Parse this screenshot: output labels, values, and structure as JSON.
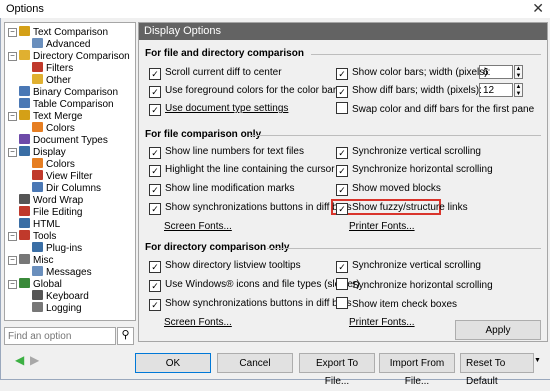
{
  "window": {
    "title": "Options",
    "close_glyph": "✕"
  },
  "tree": {
    "items": [
      {
        "label": "Text Comparison",
        "icon": "text-compare-icon",
        "color": "#d4a017"
      },
      {
        "label": "Advanced",
        "icon": "settings-icon",
        "color": "#6a8fbd"
      },
      {
        "label": "Directory Comparison",
        "icon": "folder-compare-icon",
        "color": "#e0b030"
      },
      {
        "label": "Filters",
        "icon": "filter-icon",
        "color": "#c0392b"
      },
      {
        "label": "Other",
        "icon": "folder-icon",
        "color": "#e0b030"
      },
      {
        "label": "Binary Comparison",
        "icon": "binary-icon",
        "color": "#4a78b5"
      },
      {
        "label": "Table Comparison",
        "icon": "table-icon",
        "color": "#4a78b5"
      },
      {
        "label": "Text Merge",
        "icon": "merge-icon",
        "color": "#d4a017"
      },
      {
        "label": "Colors",
        "icon": "palette-icon",
        "color": "#e67e22"
      },
      {
        "label": "Document Types",
        "icon": "document-icon",
        "color": "#6d4aa8"
      },
      {
        "label": "Display",
        "icon": "monitor-icon",
        "color": "#3a6ea5"
      },
      {
        "label": "Colors",
        "icon": "palette-icon",
        "color": "#e67e22"
      },
      {
        "label": "View Filter",
        "icon": "filter-icon",
        "color": "#c0392b"
      },
      {
        "label": "Dir Columns",
        "icon": "columns-icon",
        "color": "#4a78b5"
      },
      {
        "label": "Word Wrap",
        "icon": "wrap-icon",
        "color": "#555555"
      },
      {
        "label": "File Editing",
        "icon": "edit-icon",
        "color": "#c0392b"
      },
      {
        "label": "HTML",
        "icon": "html-icon",
        "color": "#3a6ea5"
      },
      {
        "label": "Tools",
        "icon": "tools-icon",
        "color": "#c0392b"
      },
      {
        "label": "Plug-ins",
        "icon": "plugin-icon",
        "color": "#3a6ea5"
      },
      {
        "label": "Misc",
        "icon": "misc-icon",
        "color": "#777777"
      },
      {
        "label": "Messages",
        "icon": "message-icon",
        "color": "#6a8fbd"
      },
      {
        "label": "Global",
        "icon": "globe-icon",
        "color": "#3a8a3a"
      },
      {
        "label": "Keyboard",
        "icon": "keyboard-icon",
        "color": "#555555"
      },
      {
        "label": "Logging",
        "icon": "log-icon",
        "color": "#777777"
      }
    ],
    "search_placeholder": "Find an option",
    "search_icon_glyph": "⚲"
  },
  "panel": {
    "header": "Display Options",
    "section1": {
      "title": "For file and directory comparison",
      "left": [
        {
          "label": "Scroll current diff to center",
          "checked": true
        },
        {
          "label": "Use foreground colors for the color bars",
          "checked": true
        },
        {
          "label": "Use document type settings",
          "checked": true
        }
      ],
      "right": [
        {
          "label": "Show color bars; width (pixels):",
          "checked": true,
          "value": "6"
        },
        {
          "label": "Show diff bars; width (pixels):",
          "checked": true,
          "value": "12"
        },
        {
          "label": "Swap color and diff bars for the first pane",
          "checked": false
        }
      ]
    },
    "section2": {
      "title": "For file comparison only",
      "left": [
        {
          "label": "Show line numbers for text files",
          "checked": true
        },
        {
          "label": "Highlight the line containing the cursor",
          "checked": true
        },
        {
          "label": "Show line modification marks",
          "checked": true
        },
        {
          "label": "Show synchronizations buttons in diff bars",
          "checked": true
        }
      ],
      "right": [
        {
          "label": "Synchronize vertical scrolling",
          "checked": true
        },
        {
          "label": "Synchronize horizontal scrolling",
          "checked": true
        },
        {
          "label": "Show moved blocks",
          "checked": true
        },
        {
          "label": "Show fuzzy/structure links",
          "checked": true
        }
      ],
      "screen_fonts": "Screen Fonts...",
      "printer_fonts": "Printer Fonts..."
    },
    "section3": {
      "title": "For directory comparison only",
      "left": [
        {
          "label": "Show directory listview tooltips",
          "checked": true
        },
        {
          "label": "Use Windows® icons and file types (slower)",
          "checked": true
        },
        {
          "label": "Show synchronizations buttons in diff bars",
          "checked": true
        }
      ],
      "right": [
        {
          "label": "Synchronize vertical scrolling",
          "checked": true
        },
        {
          "label": "Synchronize horizontal scrolling",
          "checked": false
        },
        {
          "label": "Show item check boxes",
          "checked": false
        }
      ],
      "screen_fonts": "Screen Fonts...",
      "printer_fonts": "Printer Fonts..."
    },
    "apply": "Apply"
  },
  "footer": {
    "back_glyph": "◀",
    "forward_glyph": "▶",
    "ok": "OK",
    "cancel": "Cancel",
    "export": "Export To File...",
    "import": "Import From File...",
    "reset": "Reset To Default",
    "reset_arrow": "▼"
  },
  "colors": {
    "header_bg": "#636363",
    "highlight": "#d9352c",
    "nav_back": "#3cb043",
    "nav_forward": "#a8a8a8"
  }
}
